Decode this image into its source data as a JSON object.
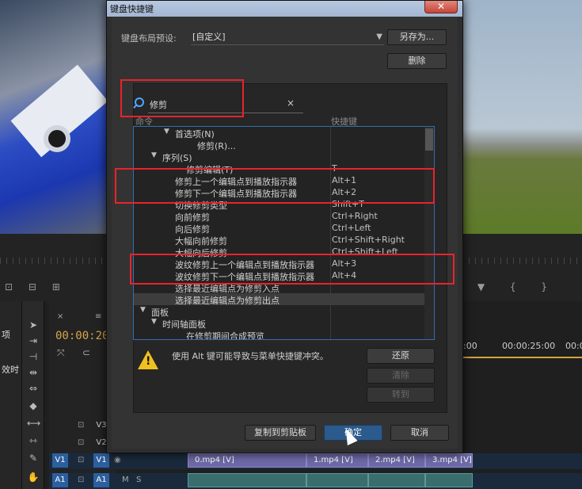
{
  "dialog": {
    "title": "键盘快捷键",
    "close_glyph": "✕",
    "preset_label": "键盘布局预设:",
    "preset_value": "[自定义]",
    "save_as_label": "另存为...",
    "delete_label": "删除",
    "search_value": "修剪",
    "search_clear": "×",
    "col_command": "命令",
    "col_shortcut": "快捷键",
    "rows": [
      {
        "indent": 1,
        "toggle": "▼",
        "label": "首选项(N)",
        "key": ""
      },
      {
        "indent": 3,
        "toggle": "",
        "label": "修剪(R)...",
        "key": ""
      },
      {
        "indent": 0,
        "toggle": "▼",
        "label": "序列(S)",
        "key": ""
      },
      {
        "indent": 2,
        "toggle": "",
        "label": "修剪编辑(T)",
        "key": "T"
      },
      {
        "indent": 1,
        "toggle": "",
        "label": "修剪上一个编辑点到播放指示器",
        "key": "Alt+1"
      },
      {
        "indent": 1,
        "toggle": "",
        "label": "修剪下一个编辑点到播放指示器",
        "key": "Alt+2"
      },
      {
        "indent": 1,
        "toggle": "",
        "label": "切换修剪类型",
        "key": "Shift+T"
      },
      {
        "indent": 1,
        "toggle": "",
        "label": "向前修剪",
        "key": "Ctrl+Right"
      },
      {
        "indent": 1,
        "toggle": "",
        "label": "向后修剪",
        "key": "Ctrl+Left"
      },
      {
        "indent": 1,
        "toggle": "",
        "label": "大幅向前修剪",
        "key": "Ctrl+Shift+Right"
      },
      {
        "indent": 1,
        "toggle": "",
        "label": "大幅向后修剪",
        "key": "Ctrl+Shift+Left"
      },
      {
        "indent": 1,
        "toggle": "",
        "label": "波纹修剪上一个编辑点到播放指示器",
        "key": "Alt+3"
      },
      {
        "indent": 1,
        "toggle": "",
        "label": "波纹修剪下一个编辑点到播放指示器",
        "key": "Alt+4"
      },
      {
        "indent": 1,
        "toggle": "",
        "label": "选择最近编辑点为修剪入点",
        "key": ""
      },
      {
        "indent": 1,
        "toggle": "",
        "label": "选择最近编辑点为修剪出点",
        "key": "",
        "selected": true
      },
      {
        "indent": -1,
        "toggle": "▼",
        "label": "面板",
        "key": ""
      },
      {
        "indent": 0,
        "toggle": "▼",
        "label": "时间轴面板",
        "key": ""
      },
      {
        "indent": 2,
        "toggle": "",
        "label": "在修剪期间合成预览",
        "key": ""
      }
    ],
    "warning_text": "使用 Alt 键可能导致与菜单快捷键冲突。",
    "restore_label": "还原",
    "clear_label": "清除",
    "goto_label": "转到",
    "copy_label": "复制到剪贴板",
    "ok_label": "确定",
    "cancel_label": "取消"
  },
  "background": {
    "side_label_1": "项",
    "side_label_2": "效时",
    "timecode": "00:00:20",
    "time_1": "0:00",
    "time_2": "00:00:25:00",
    "time_3": "00:0",
    "timeline_tab_close": "×",
    "timeline_tab_menu": "≡",
    "tracks": {
      "v3": "V3",
      "v2": "V2",
      "v1_left": "V1",
      "v1": "V1",
      "a1_left": "A1",
      "a1": "A1",
      "a1_m": "M",
      "a1_s": "S"
    },
    "clips": [
      "0.mp4 [V]",
      "1.mp4 [V]",
      "2.mp4 [V]",
      "3.mp4 [V]"
    ]
  }
}
